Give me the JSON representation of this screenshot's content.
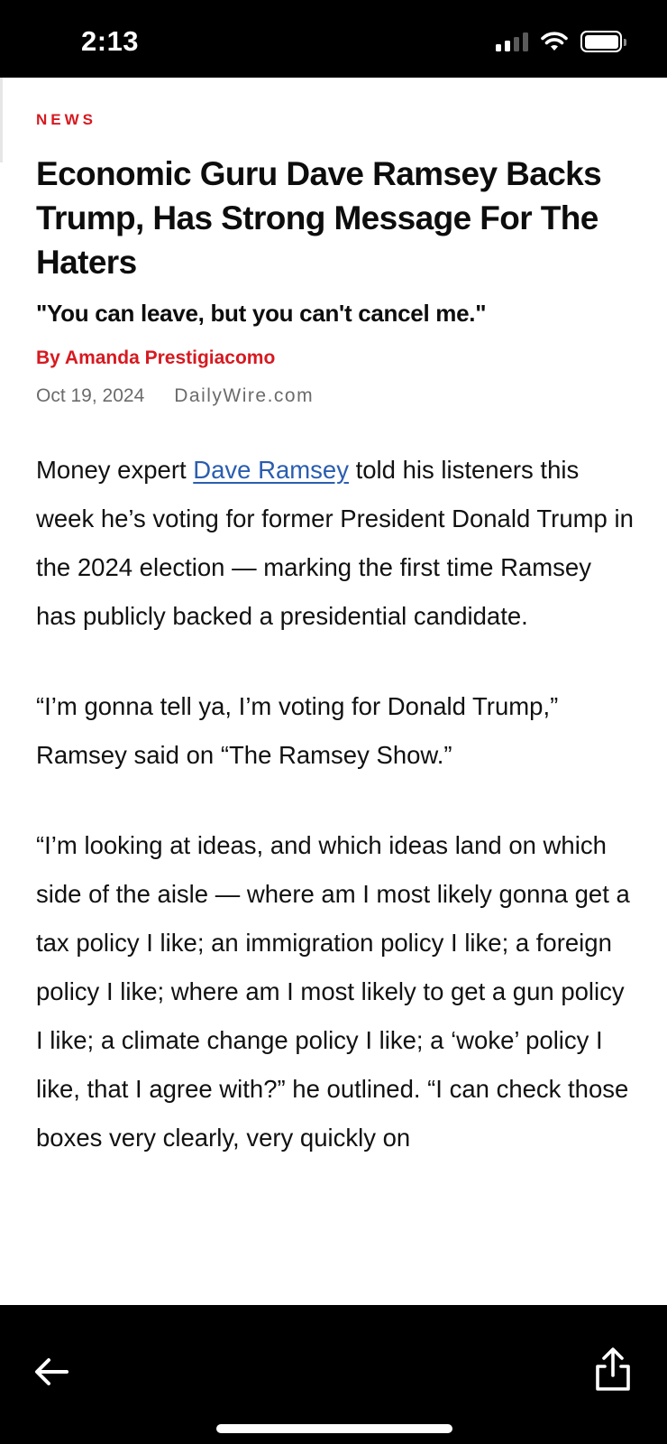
{
  "status_bar": {
    "time": "2:13",
    "icons": [
      "cellular-signal-icon",
      "wifi-icon",
      "battery-icon"
    ]
  },
  "article": {
    "section": "NEWS",
    "headline": "Economic Guru Dave Ramsey Backs Trump, Has Strong Message For The Haters",
    "subheadline": "\"You can leave, but you can't cancel me.\"",
    "byline": "By Amanda Prestigiacomo",
    "date": "Oct 19, 2024",
    "source": "DailyWire.com",
    "paragraph_1": {
      "before_link": "Money expert ",
      "link_text": "Dave Ramsey",
      "after_link": " told his listeners this week he’s voting for former President Donald Trump in the 2024 election — marking the first time Ramsey has publicly backed a presidential candidate."
    },
    "paragraph_2": "“I’m gonna tell ya, I’m voting for Donald Trump,” Ramsey said on “The Ramsey Show.”",
    "paragraph_3": "“I’m looking at ideas, and which ideas land on which side of the aisle — where am I most likely gonna get a tax policy I like; an immigration policy I like; a foreign policy I like; where am I most likely to get a gun policy I like; a climate change policy I like; a ‘woke’ policy I like, that I agree with?” he outlined. “I can check those boxes very clearly, very quickly on"
  },
  "toolbar": {
    "back_icon": "back-arrow-icon",
    "share_icon": "share-icon"
  },
  "colors": {
    "accent_red": "#d71920",
    "link_blue": "#2a5db0",
    "meta_gray": "#6b6b6b"
  }
}
